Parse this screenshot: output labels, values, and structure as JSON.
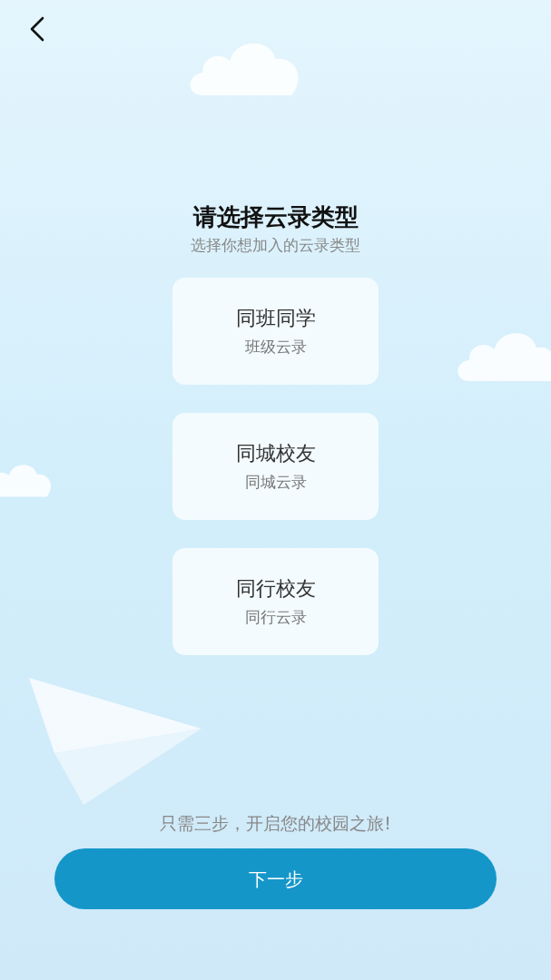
{
  "header": {
    "title": "请选择云录类型",
    "subtitle": "选择你想加入的云录类型"
  },
  "options": [
    {
      "title": "同班同学",
      "subtitle": "班级云录",
      "selected": false
    },
    {
      "title": "同城校友",
      "subtitle": "同城云录",
      "selected": false
    },
    {
      "title": "同行校友",
      "subtitle": "同行云录",
      "selected": false
    }
  ],
  "footer": {
    "hint": "只需三步，开启您的校园之旅!",
    "button": "下一步"
  }
}
